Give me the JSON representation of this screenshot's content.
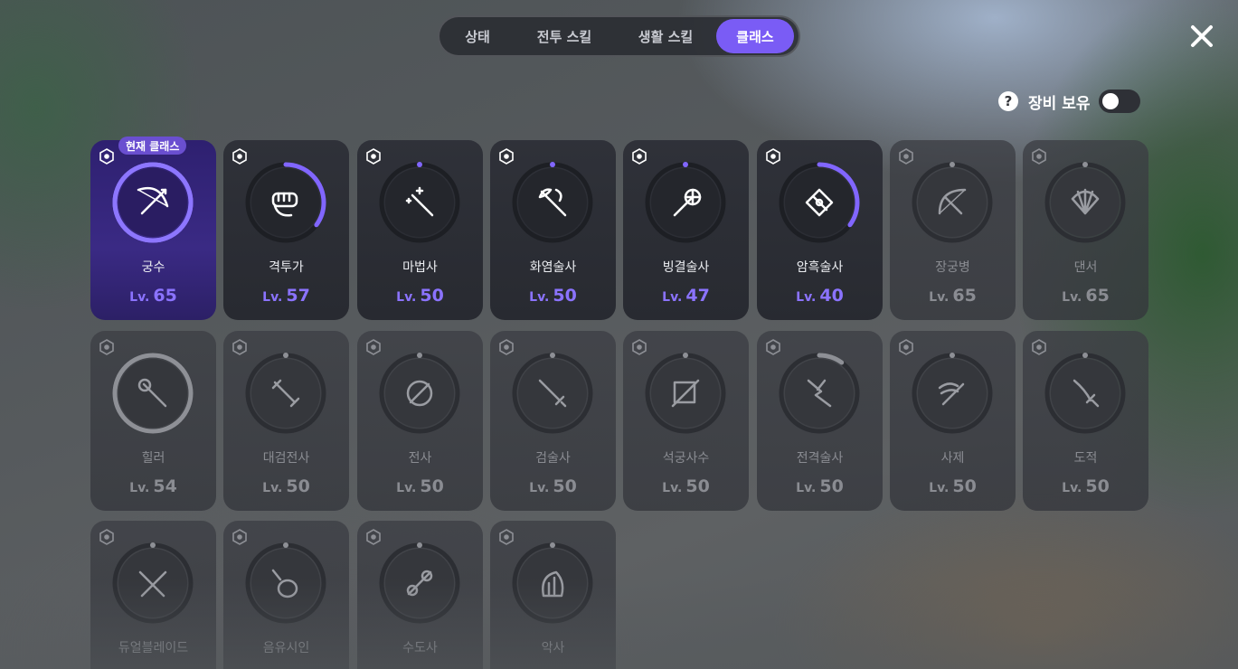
{
  "tabs": [
    {
      "label": "상태"
    },
    {
      "label": "전투 스킬"
    },
    {
      "label": "생활 스킬"
    },
    {
      "label": "클래스"
    }
  ],
  "active_tab": "클래스",
  "equip_filter": {
    "help_symbol": "?",
    "label": "장비 보유",
    "toggle_on": false
  },
  "current_badge": "현재 클래스",
  "level_prefix": "Lv.",
  "accent_color": "#7a5cf5",
  "classes": [
    {
      "name": "궁수",
      "level": "65",
      "icon": "bow-arrow-icon",
      "progress": 1.0,
      "state": "current"
    },
    {
      "name": "격투가",
      "level": "57",
      "icon": "fist-icon",
      "progress": 0.35,
      "state": "unlocked"
    },
    {
      "name": "마법사",
      "level": "50",
      "icon": "magic-wand-icon",
      "progress": 0.0,
      "state": "unlocked"
    },
    {
      "name": "화염술사",
      "level": "50",
      "icon": "flame-staff-icon",
      "progress": 0.0,
      "state": "unlocked"
    },
    {
      "name": "빙결술사",
      "level": "47",
      "icon": "ice-staff-icon",
      "progress": 0.0,
      "state": "unlocked"
    },
    {
      "name": "암흑술사",
      "level": "40",
      "icon": "dark-tome-icon",
      "progress": 0.35,
      "state": "unlocked"
    },
    {
      "name": "장궁병",
      "level": "65",
      "icon": "longbow-icon",
      "progress": 0.0,
      "state": "locked"
    },
    {
      "name": "댄서",
      "level": "65",
      "icon": "fan-icon",
      "progress": 0.0,
      "state": "locked"
    },
    {
      "name": "힐러",
      "level": "54",
      "icon": "healer-staff-icon",
      "progress": 1.0,
      "state": "locked"
    },
    {
      "name": "대검전사",
      "level": "50",
      "icon": "greatsword-icon",
      "progress": 0.0,
      "state": "locked"
    },
    {
      "name": "전사",
      "level": "50",
      "icon": "shield-sword-icon",
      "progress": 0.0,
      "state": "locked"
    },
    {
      "name": "검술사",
      "level": "50",
      "icon": "sword-icon",
      "progress": 0.0,
      "state": "locked"
    },
    {
      "name": "석궁사수",
      "level": "50",
      "icon": "crossbow-icon",
      "progress": 0.0,
      "state": "locked"
    },
    {
      "name": "전격술사",
      "level": "50",
      "icon": "lightning-icon",
      "progress": 0.1,
      "state": "locked"
    },
    {
      "name": "사제",
      "level": "50",
      "icon": "winged-scepter-icon",
      "progress": 0.0,
      "state": "locked"
    },
    {
      "name": "도적",
      "level": "50",
      "icon": "dagger-icon",
      "progress": 0.0,
      "state": "locked"
    },
    {
      "name": "듀얼블레이드",
      "level": "",
      "icon": "dual-blades-icon",
      "progress": 0.0,
      "state": "locked"
    },
    {
      "name": "음유시인",
      "level": "",
      "icon": "lute-icon",
      "progress": 0.0,
      "state": "locked"
    },
    {
      "name": "수도사",
      "level": "",
      "icon": "monk-staff-icon",
      "progress": 0.0,
      "state": "locked"
    },
    {
      "name": "악사",
      "level": "",
      "icon": "harp-icon",
      "progress": 0.0,
      "state": "locked"
    }
  ]
}
